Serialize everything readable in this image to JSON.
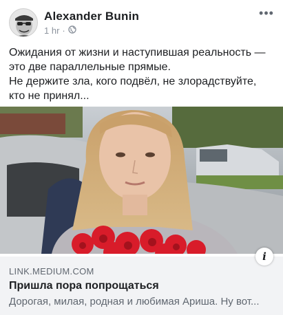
{
  "post": {
    "author": "Alexander  Bunin",
    "time": "1 hr",
    "separator": "·",
    "audience_icon": "globe-icon",
    "more_icon": "more-horizontal-icon",
    "more_label": "•••",
    "text": [
      "Ожидания от жизни и наступившая реальность —",
      "это две параллельные прямые.",
      "Не держите зла, кого подвёл, не злорадствуйте,",
      "кто не принял..."
    ]
  },
  "link_preview": {
    "domain": "LINK.MEDIUM.COM",
    "title": "Пришла пора попрощаться",
    "description": "Дорогая, милая, родная и любимая Ариша. Ну вот...",
    "info_icon": "info-icon",
    "info_label": "i"
  },
  "colors": {
    "text_primary": "#1c1e21",
    "text_secondary": "#606770",
    "link_background": "#f2f3f5",
    "flowers": "#d81c2a"
  }
}
